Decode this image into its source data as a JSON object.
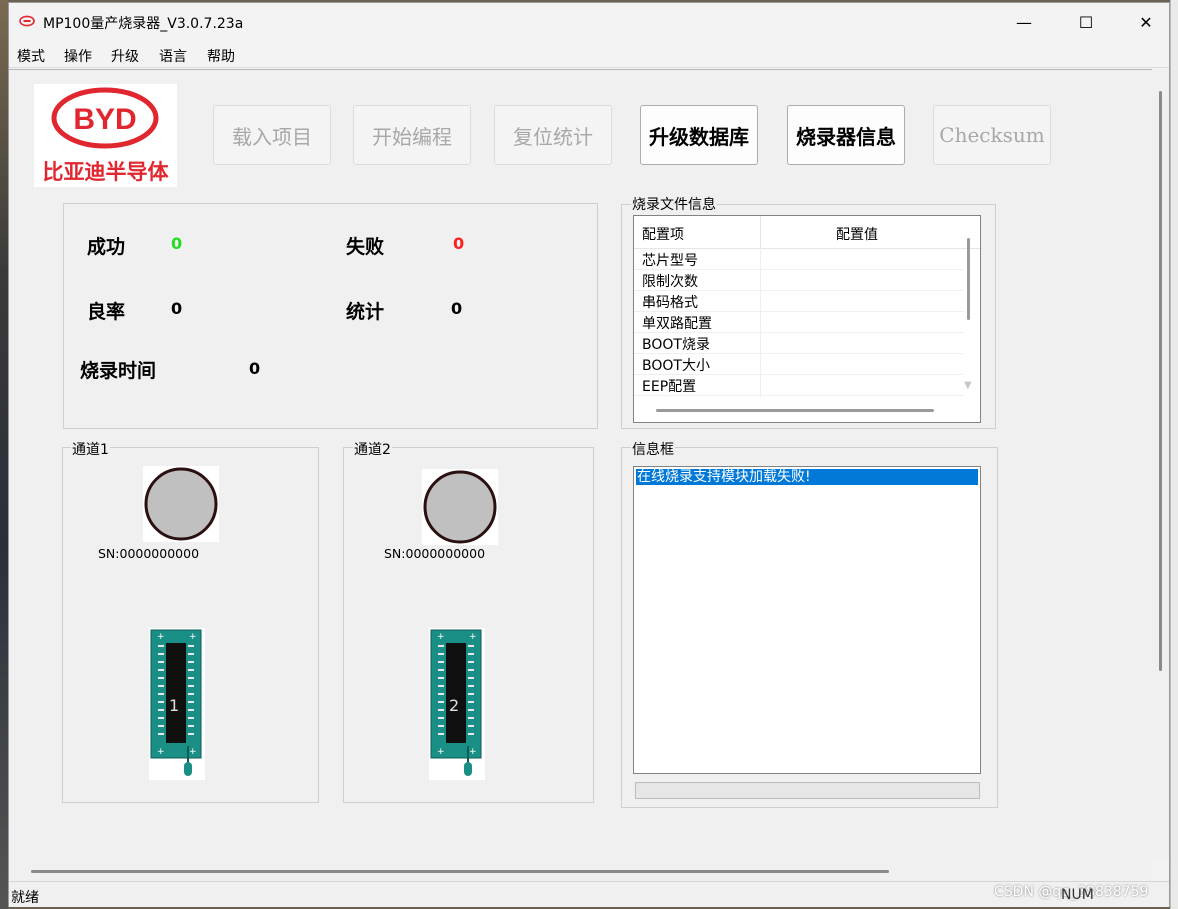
{
  "window": {
    "title": "MP100量产烧录器_V3.0.7.23a",
    "minimize_glyph": "—",
    "maximize_glyph": "☐",
    "close_glyph": "✕"
  },
  "menu": [
    "模式",
    "操作",
    "升级",
    "语言",
    "帮助"
  ],
  "logo": {
    "mark": "BYD",
    "text": "比亚迪半导体",
    "color": "#e0262e"
  },
  "toolbar": [
    {
      "label": "载入项目",
      "enabled": false
    },
    {
      "label": "开始编程",
      "enabled": false
    },
    {
      "label": "复位统计",
      "enabled": false
    },
    {
      "label": "升级数据库",
      "enabled": true
    },
    {
      "label": "烧录器信息",
      "enabled": true
    },
    {
      "label": "Checksum",
      "enabled": false
    }
  ],
  "stats": {
    "success_label": "成功",
    "success_value": "0",
    "success_color": "#22dd22",
    "fail_label": "失败",
    "fail_value": "0",
    "fail_color": "#ff2020",
    "yield_label": "良率",
    "yield_value": "0",
    "total_label": "统计",
    "total_value": "0",
    "time_label": "烧录时间",
    "time_value": "0"
  },
  "file_info": {
    "title": "烧录文件信息",
    "col_item": "配置项",
    "col_value": "配置值",
    "rows": [
      "芯片型号",
      "限制次数",
      "串码格式",
      "单双路配置",
      "BOOT烧录",
      "BOOT大小",
      "EEP配置"
    ]
  },
  "channels": [
    {
      "label": "通道1",
      "sn": "SN:0000000000",
      "number": "1"
    },
    {
      "label": "通道2",
      "sn": "SN:0000000000",
      "number": "2"
    }
  ],
  "info_box": {
    "title": "信息框",
    "messages": [
      "在线烧录支持模块加载失败!"
    ]
  },
  "statusbar": {
    "left": "就绪",
    "watermark": "CSDN @qq_38838759",
    "num": "NUM"
  },
  "colors": {
    "chip_board": "#1a8f86",
    "led_fill": "#c0c0c0",
    "selection": "#0078d7"
  }
}
